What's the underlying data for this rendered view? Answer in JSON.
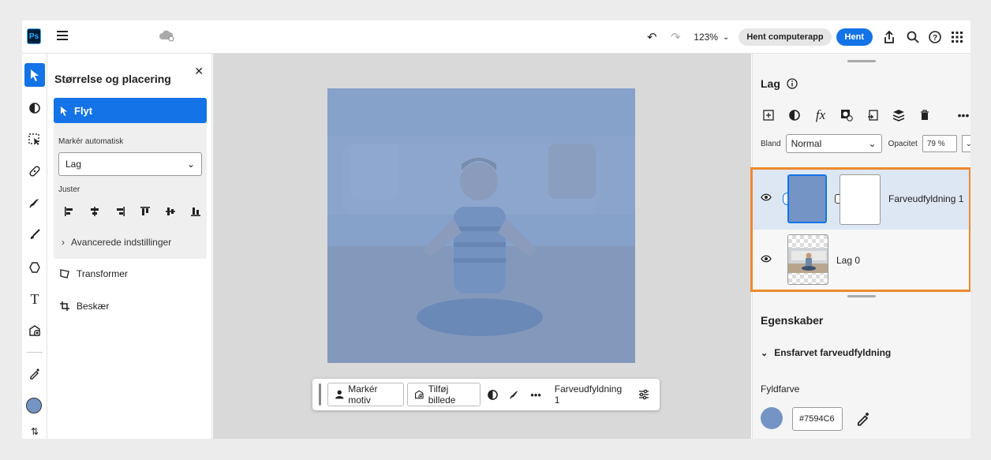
{
  "app": {
    "logo": "Ps",
    "zoom": "123%",
    "open_desktop_label": "Hent computerapp",
    "download_label": "Hent"
  },
  "tool_panel": {
    "title": "Størrelse og placering",
    "move_label": "Flyt",
    "auto_select_label": "Markér automatisk",
    "auto_select_value": "Lag",
    "align_label": "Juster",
    "advanced_label": "Avancerede indstillinger",
    "transform_label": "Transformer",
    "crop_label": "Beskær"
  },
  "context_bar": {
    "select_subject_label": "Markér motiv",
    "add_image_label": "Tilføj billede",
    "layer_label": "Farveudfyldning 1"
  },
  "layers_panel": {
    "title": "Lag",
    "blend_label": "Bland",
    "blend_value": "Normal",
    "opacity_label": "Opacitet",
    "opacity_value": "79 %",
    "layers": [
      {
        "name": "Farveudfyldning 1",
        "selected": true
      },
      {
        "name": "Lag 0",
        "selected": false
      }
    ]
  },
  "properties": {
    "title": "Egenskaber",
    "section_label": "Ensfarvet farveudfyldning",
    "fill_label": "Fyldfarve",
    "fill_hex": "#7594C6"
  },
  "colors": {
    "accent": "#1473e6",
    "fill": "#7594c6",
    "highlight_border": "#ee8a2e"
  }
}
